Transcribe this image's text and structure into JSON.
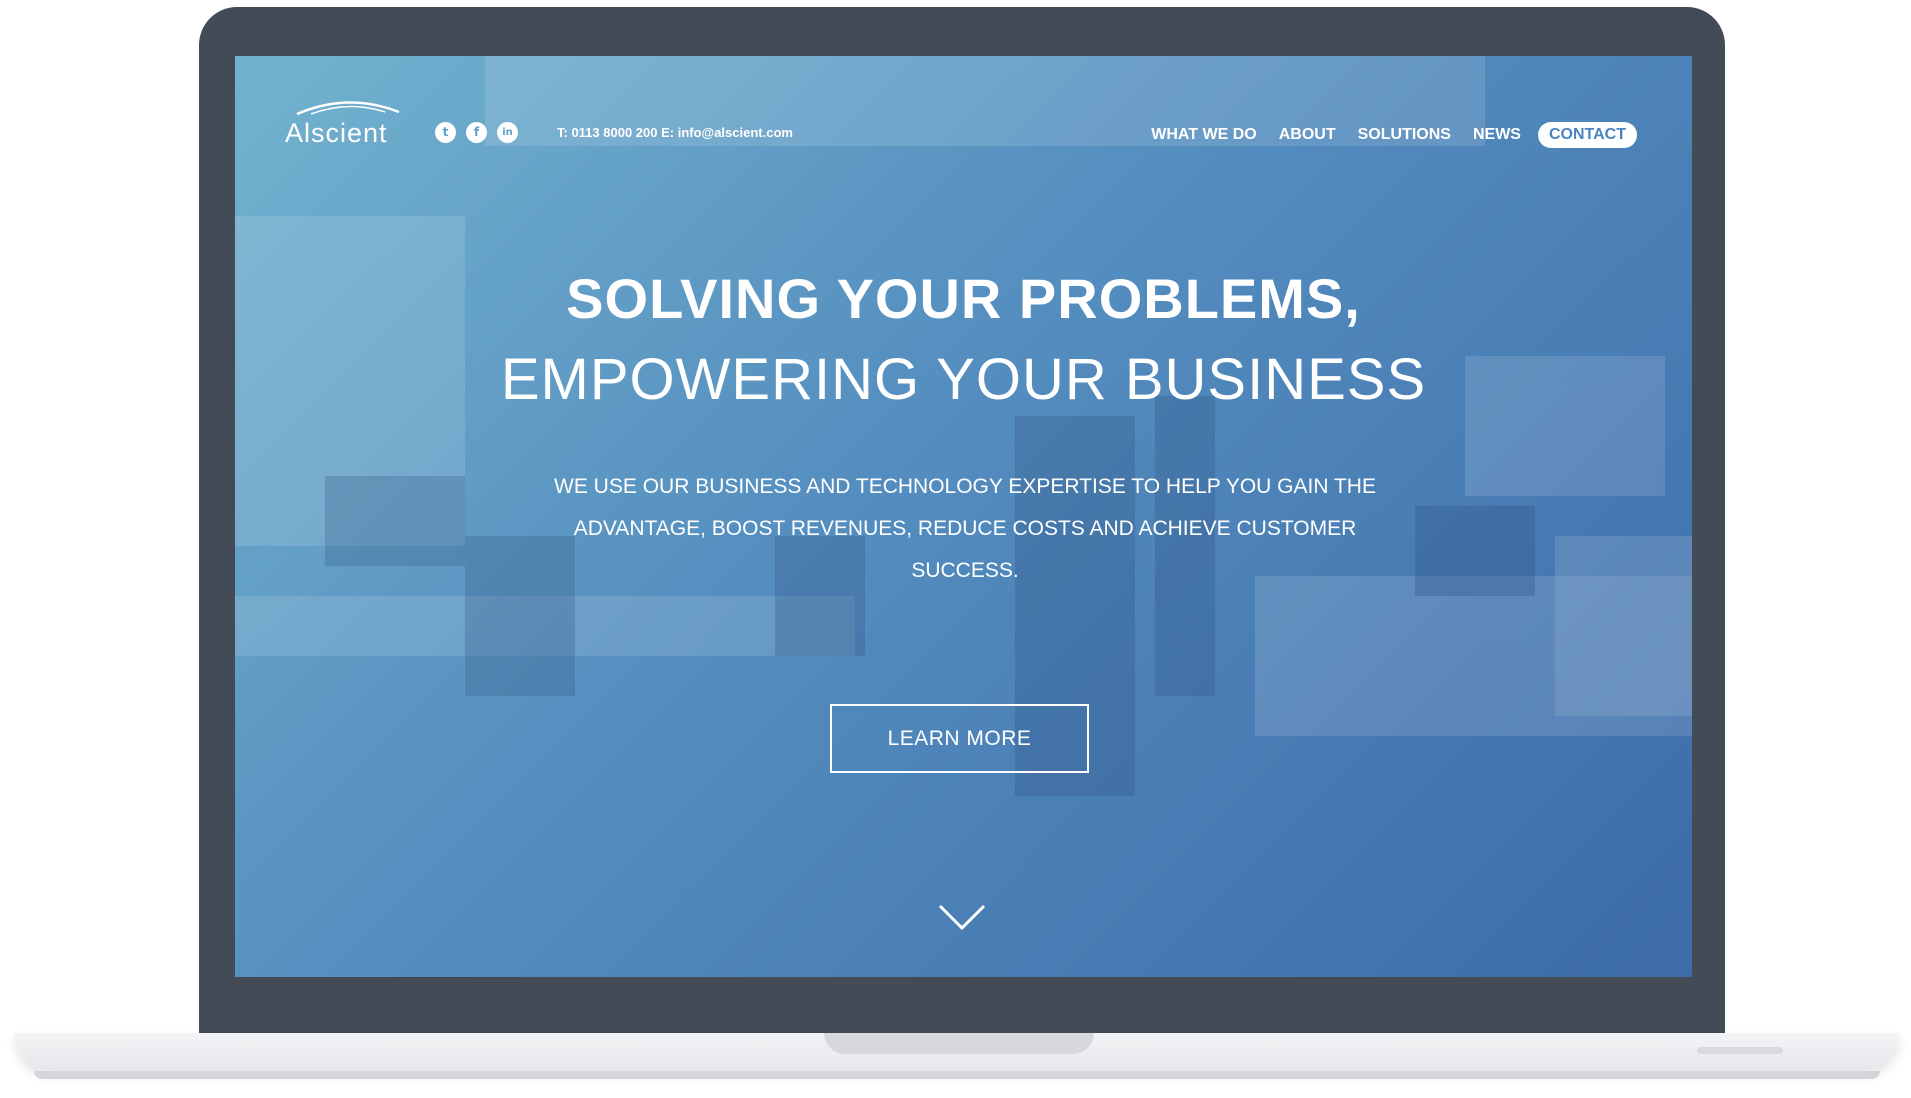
{
  "brand": {
    "name": "Alscient"
  },
  "header": {
    "social": [
      {
        "icon": "twitter-icon",
        "glyph": "t"
      },
      {
        "icon": "facebook-icon",
        "glyph": "f"
      },
      {
        "icon": "linkedin-icon",
        "glyph": "in"
      }
    ],
    "contact_line": "T: 0113 8000 200 E: info@alscient.com"
  },
  "nav": {
    "items": [
      {
        "label": "WHAT WE DO"
      },
      {
        "label": "ABOUT"
      },
      {
        "label": "SOLUTIONS"
      },
      {
        "label": "NEWS"
      }
    ],
    "contact_label": "CONTACT"
  },
  "hero": {
    "title": "SOLVING YOUR PROBLEMS,",
    "subtitle": "EMPOWERING YOUR BUSINESS",
    "description": "WE USE OUR BUSINESS AND TECHNOLOGY EXPERTISE TO HELP YOU GAIN THE ADVANTAGE, BOOST REVENUES, REDUCE COSTS AND ACHIEVE CUSTOMER SUCCESS.",
    "cta_label": "LEARN MORE",
    "scroll_icon": "chevron-down-icon"
  },
  "colors": {
    "frame": "#434b57",
    "overlay_start": "#78bedc",
    "overlay_end": "#3c6eaf",
    "accent": "#4b84c3"
  }
}
